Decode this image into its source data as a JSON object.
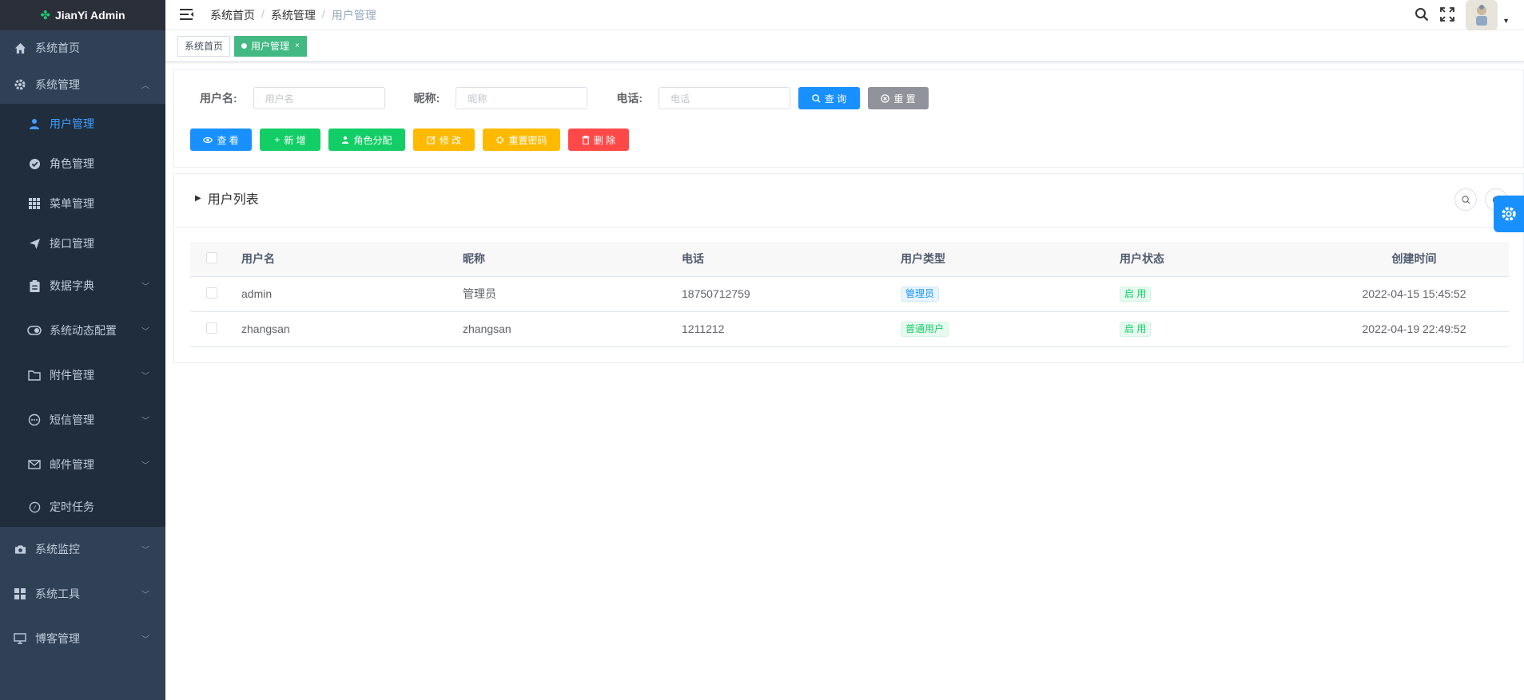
{
  "app": {
    "title": "JianYi Admin"
  },
  "sidebar": {
    "items": [
      {
        "label": "系统首页",
        "icon": "home-icon"
      },
      {
        "label": "系统管理",
        "icon": "gear-icon",
        "expanded": true,
        "children": [
          {
            "label": "用户管理",
            "icon": "user-icon",
            "active": true
          },
          {
            "label": "角色管理",
            "icon": "check-circle-icon"
          },
          {
            "label": "菜单管理",
            "icon": "grid-icon"
          },
          {
            "label": "接口管理",
            "icon": "send-icon"
          },
          {
            "label": "数据字典",
            "icon": "clipboard-icon"
          },
          {
            "label": "系统动态配置",
            "icon": "toggle-icon"
          },
          {
            "label": "附件管理",
            "icon": "folder-icon"
          },
          {
            "label": "短信管理",
            "icon": "chat-icon"
          },
          {
            "label": "邮件管理",
            "icon": "mail-icon"
          },
          {
            "label": "定时任务",
            "icon": "compass-icon"
          }
        ]
      },
      {
        "label": "系统监控",
        "icon": "camera-icon"
      },
      {
        "label": "系统工具",
        "icon": "apps-icon"
      },
      {
        "label": "博客管理",
        "icon": "monitor-icon"
      }
    ]
  },
  "breadcrumb": [
    "系统首页",
    "系统管理",
    "用户管理"
  ],
  "breadcrumb_sep": "/",
  "tags": [
    {
      "label": "系统首页"
    },
    {
      "label": "用户管理",
      "active": true,
      "close": "×"
    }
  ],
  "search": {
    "username_label": "用户名:",
    "username_placeholder": "用户名",
    "nickname_label": "昵称:",
    "nickname_placeholder": "昵称",
    "phone_label": "电话:",
    "phone_placeholder": "电话",
    "query_btn": "查 询",
    "reset_btn": "重 置"
  },
  "actions": {
    "view": "查 看",
    "add": "新 增",
    "assign_role": "角色分配",
    "edit": "修 改",
    "reset_pwd": "重置密码",
    "delete": "删 除"
  },
  "list": {
    "title": "用户列表",
    "columns": [
      "用户名",
      "昵称",
      "电话",
      "用户类型",
      "用户状态",
      "创建时间"
    ],
    "rows": [
      {
        "username": "admin",
        "nickname": "管理员",
        "phone": "18750712759",
        "type": "管理员",
        "status": "启 用",
        "created": "2022-04-15 15:45:52"
      },
      {
        "username": "zhangsan",
        "nickname": "zhangsan",
        "phone": "1211212",
        "type": "普通用户",
        "status": "启 用",
        "created": "2022-04-19 22:49:52"
      }
    ]
  },
  "colors": {
    "sidebar_bg": "#304156",
    "accent": "#1890ff",
    "tag_active": "#42b983"
  }
}
